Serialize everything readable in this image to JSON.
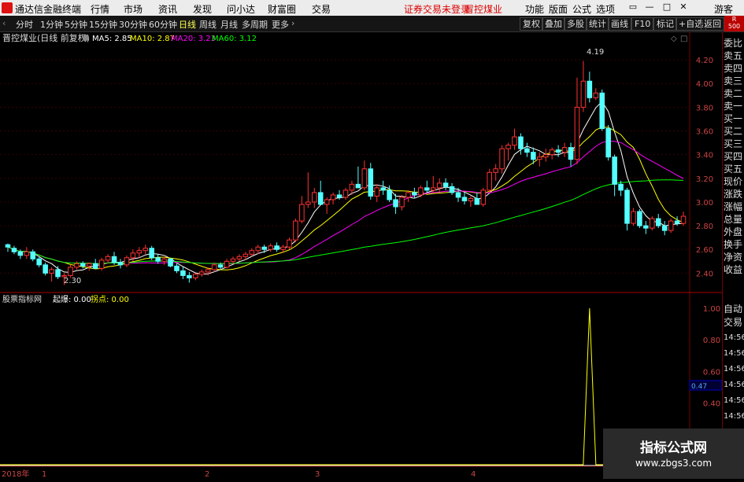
{
  "app": {
    "name": "通达信金融终端",
    "menus": [
      "行情",
      "市场",
      "资讯",
      "发现",
      "问小达",
      "财富圈",
      "交易"
    ],
    "warning": "证券交易未登录",
    "stock": "冒控煤业",
    "right_menus": [
      "功能",
      "版面",
      "公式",
      "选项"
    ],
    "guest": "游客",
    "badge_top": "R",
    "badge_bottom": "500"
  },
  "toolbar": {
    "periods": [
      "分时",
      "1分钟",
      "5分钟",
      "15分钟",
      "30分钟",
      "60分钟",
      "日线",
      "周线",
      "月线",
      "多周期",
      "更多"
    ],
    "active": "日线",
    "right_buttons": [
      "复权",
      "叠加",
      "多股",
      "统计",
      "画线",
      "F10",
      "标记",
      "+自选",
      "返回"
    ]
  },
  "main_chart": {
    "title": "晋控煤业(日线 前复权)",
    "ma": [
      {
        "label": "MA5: 2.85",
        "color": "#ffffff"
      },
      {
        "label": "MA10: 2.87",
        "color": "#ffff00"
      },
      {
        "label": "MA20: 3.23",
        "color": "#ff00ff"
      },
      {
        "label": "MA60: 3.12",
        "color": "#00ff00"
      }
    ],
    "price_ticks": [
      "4.20",
      "4.00",
      "3.80",
      "3.60",
      "3.40",
      "3.20",
      "3.00",
      "2.80",
      "2.60",
      "2.40"
    ],
    "high_label": "4.19",
    "low_label": "2.30"
  },
  "indicator": {
    "title": "股票指标网",
    "params": [
      {
        "label": "起爆: 0.00",
        "color": "#ffffff"
      },
      {
        "label": "拐点: 0.00",
        "color": "#ffff00"
      }
    ],
    "ticks": [
      "1.00",
      "0.80",
      "0.60",
      "0.40",
      "0.20"
    ],
    "cursor_value": "0.47"
  },
  "x_axis": {
    "labels": [
      "2018年",
      "1",
      "2",
      "3",
      "4"
    ]
  },
  "side": {
    "items": [
      "委比",
      "卖五",
      "卖四",
      "卖三",
      "卖二",
      "卖一",
      "买一",
      "买二",
      "买三",
      "买四",
      "买五",
      "现价",
      "涨跌",
      "涨幅",
      "总量",
      "外盘",
      "换手",
      "净资",
      "收益"
    ],
    "lower": [
      "自动",
      "交易"
    ],
    "times": [
      "14:56",
      "14:56",
      "14:56",
      "14:56",
      "14:56",
      "14:56",
      "14:56",
      "14:56"
    ]
  },
  "watermark": {
    "title": "指标公式网",
    "url": "www.zbgs3.com"
  },
  "chart_data": {
    "type": "candlestick",
    "ylim": [
      2.25,
      4.32
    ],
    "candles": [
      [
        2.64,
        2.65,
        2.58,
        2.62
      ],
      [
        2.61,
        2.63,
        2.56,
        2.58
      ],
      [
        2.58,
        2.6,
        2.52,
        2.55
      ],
      [
        2.55,
        2.62,
        2.52,
        2.58
      ],
      [
        2.58,
        2.6,
        2.5,
        2.52
      ],
      [
        2.52,
        2.54,
        2.45,
        2.47
      ],
      [
        2.47,
        2.49,
        2.38,
        2.4
      ],
      [
        2.4,
        2.45,
        2.33,
        2.43
      ],
      [
        2.43,
        2.46,
        2.35,
        2.37
      ],
      [
        2.37,
        2.4,
        2.3,
        2.38
      ],
      [
        2.38,
        2.47,
        2.36,
        2.45
      ],
      [
        2.45,
        2.5,
        2.43,
        2.48
      ],
      [
        2.48,
        2.5,
        2.44,
        2.46
      ],
      [
        2.46,
        2.49,
        2.42,
        2.48
      ],
      [
        2.48,
        2.52,
        2.46,
        2.44
      ],
      [
        2.44,
        2.53,
        2.42,
        2.51
      ],
      [
        2.51,
        2.56,
        2.48,
        2.54
      ],
      [
        2.54,
        2.58,
        2.47,
        2.49
      ],
      [
        2.49,
        2.52,
        2.44,
        2.47
      ],
      [
        2.47,
        2.55,
        2.45,
        2.53
      ],
      [
        2.53,
        2.6,
        2.5,
        2.57
      ],
      [
        2.57,
        2.62,
        2.53,
        2.59
      ],
      [
        2.59,
        2.64,
        2.56,
        2.61
      ],
      [
        2.61,
        2.63,
        2.51,
        2.53
      ],
      [
        2.53,
        2.56,
        2.48,
        2.5
      ],
      [
        2.5,
        2.54,
        2.47,
        2.52
      ],
      [
        2.52,
        2.53,
        2.45,
        2.46
      ],
      [
        2.46,
        2.48,
        2.4,
        2.42
      ],
      [
        2.42,
        2.45,
        2.35,
        2.38
      ],
      [
        2.38,
        2.41,
        2.32,
        2.36
      ],
      [
        2.36,
        2.4,
        2.34,
        2.39
      ],
      [
        2.39,
        2.43,
        2.37,
        2.41
      ],
      [
        2.41,
        2.45,
        2.38,
        2.43
      ],
      [
        2.43,
        2.49,
        2.41,
        2.47
      ],
      [
        2.47,
        2.49,
        2.43,
        2.45
      ],
      [
        2.45,
        2.52,
        2.44,
        2.5
      ],
      [
        2.5,
        2.54,
        2.48,
        2.52
      ],
      [
        2.52,
        2.56,
        2.5,
        2.54
      ],
      [
        2.54,
        2.58,
        2.51,
        2.56
      ],
      [
        2.56,
        2.61,
        2.54,
        2.59
      ],
      [
        2.59,
        2.64,
        2.56,
        2.62
      ],
      [
        2.62,
        2.64,
        2.57,
        2.6
      ],
      [
        2.6,
        2.65,
        2.58,
        2.63
      ],
      [
        2.63,
        2.66,
        2.58,
        2.6
      ],
      [
        2.6,
        2.64,
        2.57,
        2.62
      ],
      [
        2.62,
        2.7,
        2.6,
        2.68
      ],
      [
        2.68,
        2.86,
        2.66,
        2.84
      ],
      [
        2.84,
        3.05,
        2.82,
        2.98
      ],
      [
        2.98,
        3.25,
        2.95,
        3.0
      ],
      [
        3.0,
        3.12,
        2.95,
        3.08
      ],
      [
        3.08,
        3.18,
        3.02,
        2.98
      ],
      [
        2.98,
        3.04,
        2.9,
        3.02
      ],
      [
        3.02,
        3.08,
        2.98,
        3.06
      ],
      [
        3.06,
        3.1,
        3.02,
        3.04
      ],
      [
        3.04,
        3.12,
        3.02,
        3.1
      ],
      [
        3.1,
        3.18,
        3.06,
        3.15
      ],
      [
        3.15,
        3.3,
        3.12,
        3.12
      ],
      [
        3.12,
        3.35,
        3.1,
        3.28
      ],
      [
        3.28,
        3.33,
        3.02,
        3.05
      ],
      [
        3.05,
        3.15,
        3.0,
        3.12
      ],
      [
        3.12,
        3.18,
        3.06,
        3.1
      ],
      [
        3.1,
        3.14,
        3.0,
        3.02
      ],
      [
        3.02,
        3.07,
        2.9,
        2.96
      ],
      [
        2.96,
        3.06,
        2.93,
        3.04
      ],
      [
        3.04,
        3.1,
        3.0,
        3.08
      ],
      [
        3.08,
        3.12,
        3.03,
        3.06
      ],
      [
        3.06,
        3.14,
        3.04,
        3.12
      ],
      [
        3.12,
        3.18,
        3.08,
        3.1
      ],
      [
        3.1,
        3.22,
        3.08,
        3.12
      ],
      [
        3.12,
        3.2,
        3.08,
        3.16
      ],
      [
        3.16,
        3.2,
        3.1,
        3.13
      ],
      [
        3.13,
        3.16,
        3.06,
        3.08
      ],
      [
        3.08,
        3.12,
        3.0,
        3.04
      ],
      [
        3.04,
        3.08,
        2.98,
        3.01
      ],
      [
        3.01,
        3.05,
        2.96,
        3.03
      ],
      [
        3.03,
        3.08,
        2.98,
        2.98
      ],
      [
        2.98,
        3.12,
        2.96,
        3.1
      ],
      [
        3.1,
        3.28,
        3.08,
        3.25
      ],
      [
        3.25,
        3.32,
        3.18,
        3.28
      ],
      [
        3.28,
        3.48,
        3.24,
        3.45
      ],
      [
        3.45,
        3.5,
        3.35,
        3.48
      ],
      [
        3.48,
        3.62,
        3.44,
        3.55
      ],
      [
        3.55,
        3.58,
        3.4,
        3.45
      ],
      [
        3.45,
        3.5,
        3.38,
        3.42
      ],
      [
        3.42,
        3.46,
        3.32,
        3.36
      ],
      [
        3.36,
        3.42,
        3.3,
        3.38
      ],
      [
        3.38,
        3.45,
        3.34,
        3.4
      ],
      [
        3.4,
        3.46,
        3.36,
        3.44
      ],
      [
        3.44,
        3.48,
        3.38,
        3.42
      ],
      [
        3.42,
        3.5,
        3.38,
        3.46
      ],
      [
        3.46,
        3.5,
        3.3,
        3.36
      ],
      [
        3.36,
        4.05,
        3.32,
        3.8
      ],
      [
        3.8,
        4.19,
        3.76,
        4.02
      ],
      [
        4.02,
        4.1,
        3.84,
        3.88
      ],
      [
        3.88,
        3.96,
        3.86,
        3.92
      ],
      [
        3.92,
        3.95,
        3.6,
        3.62
      ],
      [
        3.62,
        3.65,
        3.35,
        3.38
      ],
      [
        3.38,
        3.4,
        3.05,
        3.15
      ],
      [
        3.15,
        3.18,
        3.05,
        3.1
      ],
      [
        3.1,
        3.12,
        2.76,
        2.82
      ],
      [
        2.82,
        2.95,
        2.8,
        2.92
      ],
      [
        2.92,
        2.94,
        2.78,
        2.8
      ],
      [
        2.8,
        2.84,
        2.73,
        2.78
      ],
      [
        2.78,
        2.88,
        2.76,
        2.86
      ],
      [
        2.86,
        2.9,
        2.78,
        2.8
      ],
      [
        2.8,
        2.84,
        2.72,
        2.76
      ],
      [
        2.76,
        2.86,
        2.74,
        2.84
      ],
      [
        2.84,
        2.88,
        2.8,
        2.82
      ],
      [
        2.82,
        2.92,
        2.8,
        2.88
      ]
    ],
    "indicator_signals": [
      {
        "index": 93,
        "value": 1.0
      }
    ]
  }
}
